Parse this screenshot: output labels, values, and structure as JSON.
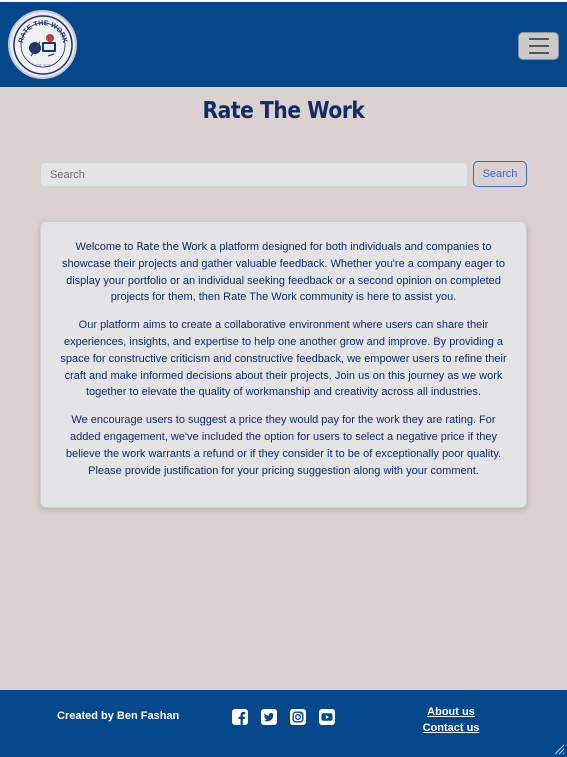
{
  "header": {
    "logo": {
      "text": "RATE THE WORK",
      "subtext": "EST. 2023",
      "icon": "rate-the-work-logo"
    },
    "menu_icon": "hamburger-icon"
  },
  "main": {
    "title": "Rate The Work",
    "search": {
      "placeholder": "Search",
      "button_label": "Search"
    },
    "intro": {
      "p1_prefix": "Welcome to ",
      "p1_brand": "Rate the Work",
      "p1_rest": " a platform designed for both individuals and companies to showcase their projects and gather valuable feedback. Whether you're a company eager to display your portfolio or an individual seeking feedback or a second opinion on completed projects for them, then Rate The Work community is here to assist you.",
      "p2": "Our platform aims to create a collaborative environment where users can share their experiences, insights, and expertise to help one another grow and improve. By providing a space for constructive criticism and constructive feedback, we empower users to refine their craft and make informed decisions about their projects. Join us on this journey as we work together to elevate the quality of workmanship and creativity across all industries.",
      "p3": "We encourage users to suggest a price they would pay for the work they are rating. For added engagement, we've included the option for users to select a negative price if they believe the work warrants a refund or if they consider it to be of exceptionally poor quality. Please provide justification for your pricing suggestion along with your comment."
    }
  },
  "footer": {
    "credit": "Created by Ben Fashan",
    "socials": [
      "facebook-icon",
      "twitter-icon",
      "instagram-icon",
      "youtube-icon"
    ],
    "about_label": "About us",
    "contact_label": "Contact us"
  },
  "colors": {
    "header_bg": "#04478a",
    "page_bg": "#dcd1d1",
    "title": "#102c65",
    "search_accent": "#2f6bd0"
  }
}
